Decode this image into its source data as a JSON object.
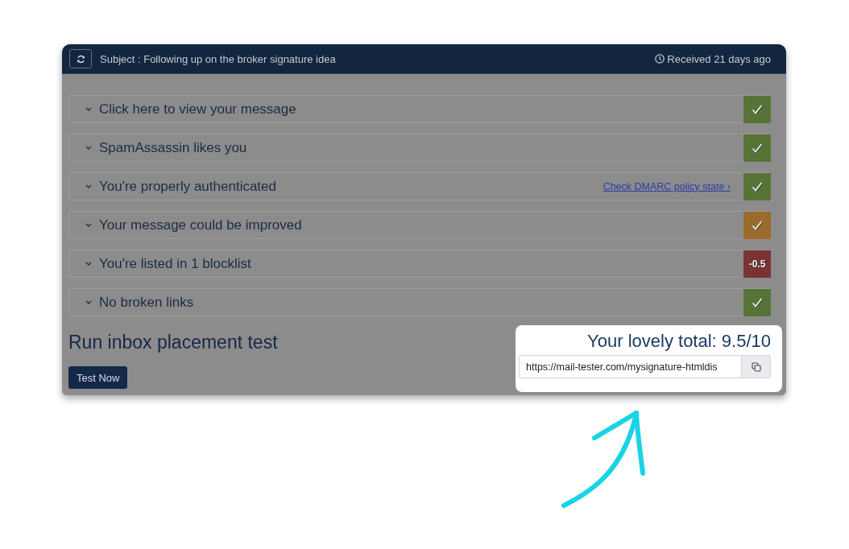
{
  "header": {
    "subject": "Subject : Following up on the broker signature idea",
    "received": "Received 21 days ago"
  },
  "checks": [
    {
      "title": "Click here to view your message",
      "kind": "tick",
      "color": "#587337"
    },
    {
      "title": "SpamAssassin likes you",
      "kind": "tick",
      "color": "#587337"
    },
    {
      "title": "You're properly authenticated",
      "kind": "tick",
      "color": "#587337",
      "link": "Check DMARC policy state ›"
    },
    {
      "title": "Your message could be improved",
      "kind": "tick",
      "color": "#9c6a2a"
    },
    {
      "title": "You're listed in 1 blocklist",
      "kind": "score",
      "color": "#7a3235",
      "score": "-0.5"
    },
    {
      "title": "No broken links",
      "kind": "tick",
      "color": "#587337"
    }
  ],
  "placement": {
    "title": "Run inbox placement test",
    "button": "Test Now"
  },
  "total": {
    "label": "Your lovely total: 9.5/10",
    "url": "https://mail-tester.com/mysignature-htmldis"
  }
}
